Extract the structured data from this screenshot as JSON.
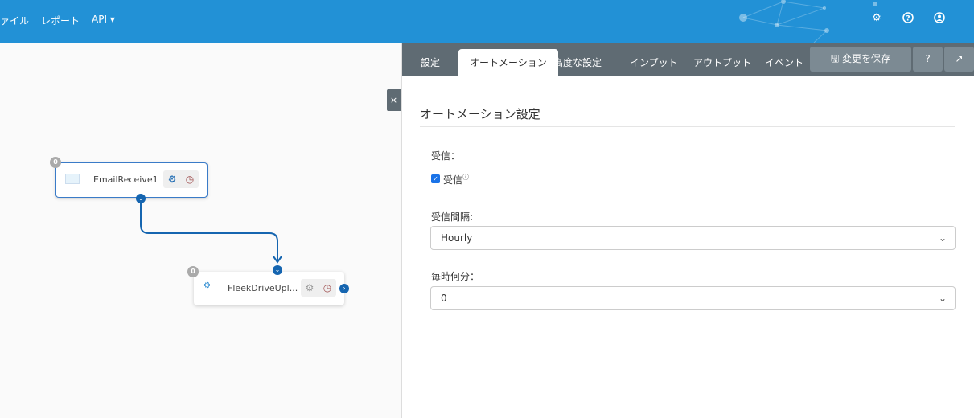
{
  "header": {
    "nav": [
      "ァイル",
      "レポート",
      "API"
    ],
    "api_caret": "▾"
  },
  "canvas": {
    "nodes": [
      {
        "name": "EmailReceive1",
        "count": "0"
      },
      {
        "name": "FleekDriveUpl...",
        "count": "0"
      }
    ]
  },
  "panel": {
    "tabs": [
      "設定",
      "オートメーション",
      "高度な設定",
      "インプット",
      "アウトプット",
      "イベント"
    ],
    "save_label": "変更を保存",
    "close_label": "×",
    "heading": "オートメーション設定",
    "receive_label": "受信：",
    "receive_checkbox": "受信",
    "interval_label": "受信間隔:",
    "interval_value": "Hourly",
    "minute_label": "毎時何分：",
    "minute_value": "0"
  },
  "colors": {
    "header": "#2291d6",
    "tabbar": "#5f6b73",
    "accent": "#1565b0"
  }
}
